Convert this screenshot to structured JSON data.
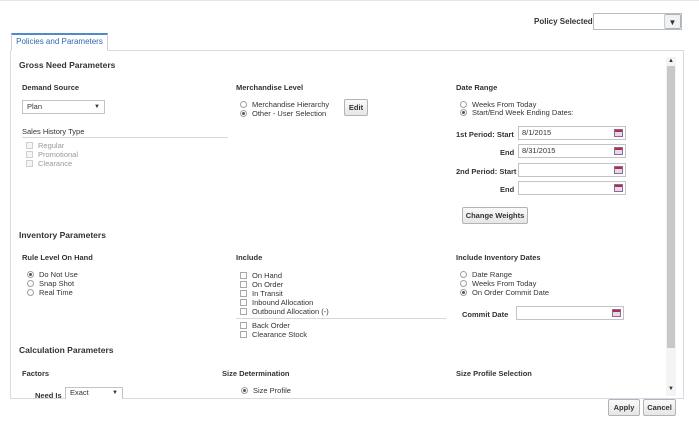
{
  "header": {
    "policy_label": "Policy Selected",
    "policy_value": "",
    "caret": "▼"
  },
  "tabs": [
    {
      "label": "Policies and Parameters"
    }
  ],
  "gross_need": {
    "title": "Gross Need Parameters",
    "demand_source": {
      "label": "Demand Source",
      "value": "Plan",
      "caret": "▼"
    },
    "sales_history": {
      "label": "Sales History Type",
      "options": [
        "Regular",
        "Promotional",
        "Clearance"
      ]
    },
    "merchandise_level": {
      "label": "Merchandise Level",
      "options": [
        "Merchandise Hierarchy",
        "Other - User Selection"
      ],
      "selected": 1,
      "edit_label": "Edit"
    },
    "date_range": {
      "label": "Date Range",
      "options": [
        "Weeks From Today",
        "Start/End Week Ending Dates:"
      ],
      "selected": 1,
      "first_start_label": "1st Period: Start",
      "first_start_value": "8/1/2015",
      "first_end_label": "End",
      "first_end_value": "8/31/2015",
      "second_start_label": "2nd Period: Start",
      "second_start_value": "",
      "second_end_label": "End",
      "second_end_value": "",
      "change_weights_label": "Change Weights"
    }
  },
  "inventory": {
    "title": "Inventory Parameters",
    "rule_level": {
      "label": "Rule Level On Hand",
      "options": [
        "Do Not Use",
        "Snap Shot",
        "Real Time"
      ],
      "selected": 0
    },
    "include": {
      "label": "Include",
      "options": [
        "On Hand",
        "On Order",
        "In Transit",
        "Inbound Allocation",
        "Outbound Allocation (-)"
      ],
      "extra": [
        "Back Order",
        "Clearance Stock"
      ]
    },
    "include_dates": {
      "label": "Include Inventory Dates",
      "options": [
        "Date Range",
        "Weeks From Today",
        "On Order Commit Date"
      ],
      "selected": 2,
      "commit_label": "Commit Date",
      "commit_value": ""
    }
  },
  "calculation": {
    "title": "Calculation Parameters",
    "factors": {
      "label": "Factors",
      "need_is_label": "Need Is",
      "need_is_value": "Exact",
      "caret": "▼"
    },
    "size_determination": {
      "label": "Size Determination",
      "option": "Size Profile"
    },
    "size_profile_selection": {
      "label": "Size Profile Selection"
    }
  },
  "footer": {
    "apply_label": "Apply",
    "cancel_label": "Cancel"
  },
  "scroll": {
    "up": "▲",
    "down": "▼"
  }
}
